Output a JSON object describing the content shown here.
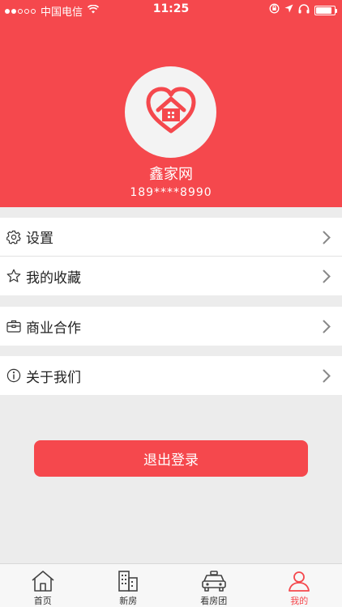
{
  "status_bar": {
    "carrier": "中国电信",
    "time": "11:25",
    "battery_level": 0.85
  },
  "profile": {
    "name": "鑫家网",
    "phone": "189****8990",
    "avatar_icon": "heart-house-icon"
  },
  "menu": {
    "groups": [
      {
        "items": [
          {
            "label": "设置",
            "icon": "gear-icon"
          },
          {
            "label": "我的收藏",
            "icon": "star-icon"
          }
        ]
      },
      {
        "items": [
          {
            "label": "商业合作",
            "icon": "briefcase-icon"
          }
        ]
      },
      {
        "items": [
          {
            "label": "关于我们",
            "icon": "info-icon"
          }
        ]
      }
    ]
  },
  "logout_label": "退出登录",
  "tabs": [
    {
      "label": "首页",
      "icon": "home-icon",
      "active": false
    },
    {
      "label": "新房",
      "icon": "building-icon",
      "active": false
    },
    {
      "label": "看房团",
      "icon": "car-icon",
      "active": false
    },
    {
      "label": "我的",
      "icon": "user-icon",
      "active": true
    }
  ],
  "colors": {
    "brand": "#f5484d",
    "background": "#ececec",
    "tab_active": "#f5484d"
  }
}
